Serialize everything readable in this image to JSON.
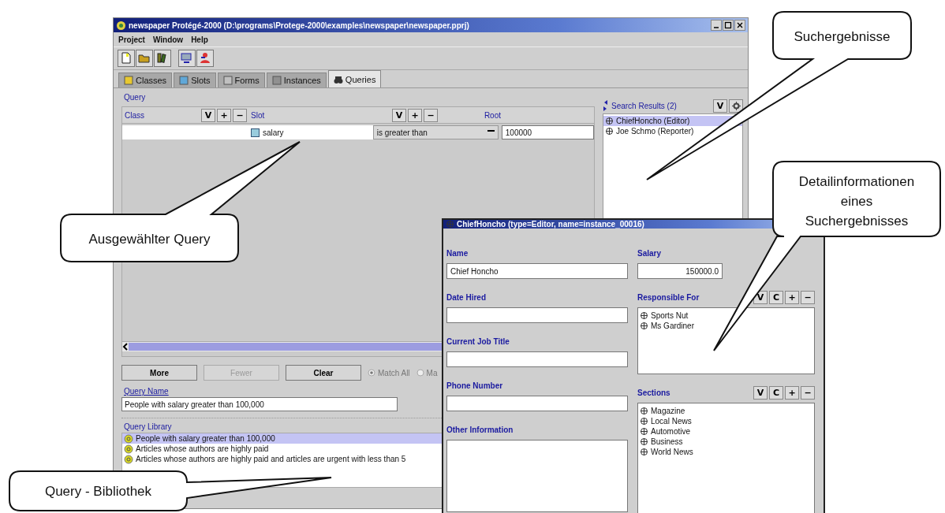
{
  "main_window": {
    "title": "newspaper  Protégé-2000   (D:\\programs\\Protege-2000\\examples\\newspaper\\newspaper.pprj)",
    "menu": [
      "Project",
      "Window",
      "Help"
    ],
    "tabs": [
      {
        "label": "Classes",
        "selected": false
      },
      {
        "label": "Slots",
        "selected": false
      },
      {
        "label": "Forms",
        "selected": false
      },
      {
        "label": "Instances",
        "selected": false
      },
      {
        "label": "Queries",
        "selected": true
      }
    ],
    "query": {
      "title": "Query",
      "columns": [
        {
          "label": "Class",
          "buttons": [
            "V",
            "+",
            "−"
          ]
        },
        {
          "label": "Slot",
          "buttons": [
            "V",
            "+",
            "−"
          ]
        },
        {
          "label": "Root"
        }
      ],
      "row": {
        "slot": "salary",
        "operator": "is greater than",
        "value": "100000"
      },
      "buttons": [
        {
          "label": "More",
          "disabled": false
        },
        {
          "label": "Fewer",
          "disabled": true
        },
        {
          "label": "Clear",
          "disabled": false
        }
      ],
      "match": [
        {
          "label": "Match All",
          "selected": true
        },
        {
          "label": "Ma",
          "selected": false
        }
      ]
    },
    "query_name": {
      "label": "Query Name",
      "value": "People with salary greater than 100,000"
    },
    "query_library": {
      "label": "Query Library",
      "items": [
        {
          "text": "People with salary greater than 100,000",
          "selected": true
        },
        {
          "text": "Articles whose authors are highly paid",
          "selected": false
        },
        {
          "text": "Articles whose authors are highly paid and articles are urgent with less than 5",
          "selected": false
        }
      ]
    },
    "search_results": {
      "title": "Search Results (2)",
      "buttons": [
        "V"
      ],
      "items": [
        {
          "text": "ChiefHoncho  (Editor)",
          "selected": true
        },
        {
          "text": "Joe Schmo  (Reporter)",
          "selected": false
        }
      ]
    }
  },
  "detail_window": {
    "title": "ChiefHoncho   (type=Editor, name=instance_00016)",
    "left": [
      {
        "kind": "text",
        "label": "Name",
        "value": "Chief Honcho"
      },
      {
        "kind": "text",
        "label": "Date Hired"
      },
      {
        "kind": "text",
        "label": "Current Job Title"
      },
      {
        "kind": "text",
        "label": "Phone Number"
      },
      {
        "kind": "textarea",
        "label": "Other Information"
      }
    ],
    "right": [
      {
        "kind": "number",
        "label": "Salary",
        "value": "150000.0"
      },
      {
        "kind": "list",
        "label": "Responsible For",
        "buttons": [
          "V",
          "C",
          "+",
          "−"
        ],
        "items": [
          "Sports Nut",
          "Ms Gardiner"
        ]
      },
      {
        "kind": "list",
        "label": "Sections",
        "buttons": [
          "V",
          "C",
          "+",
          "−"
        ],
        "items": [
          "Magazine",
          "Local News",
          "Automotive",
          "Business",
          "World News"
        ]
      }
    ]
  },
  "callouts": [
    {
      "lines": [
        "Suchergebnisse"
      ]
    },
    {
      "lines": [
        "Detailinformationen",
        "eines",
        "Suchergebnisses"
      ]
    },
    {
      "lines": [
        "Ausgewählter Query"
      ]
    },
    {
      "lines": [
        "Query - Bibliothek"
      ]
    }
  ]
}
